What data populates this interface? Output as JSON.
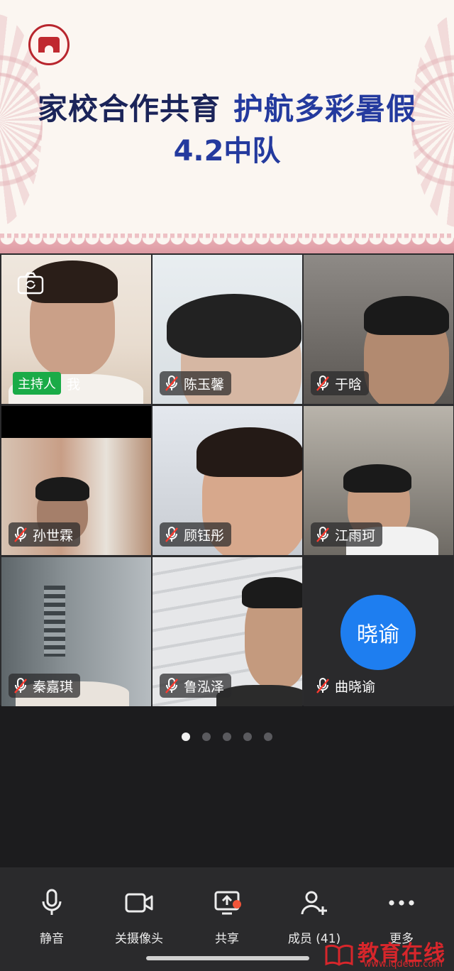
{
  "banner": {
    "title_part1": "家校合作共育",
    "title_part2": "护航多彩暑假",
    "subtitle": "4.2中队"
  },
  "participants": [
    {
      "name": "我",
      "host_label": "主持人",
      "is_host": true,
      "mic_muted": false
    },
    {
      "name": "陈玉馨",
      "mic_muted": true
    },
    {
      "name": "于晗",
      "mic_muted": true
    },
    {
      "name": "孙世霖",
      "mic_muted": true
    },
    {
      "name": "顾钰彤",
      "mic_muted": true
    },
    {
      "name": "江雨珂",
      "mic_muted": true
    },
    {
      "name": "秦嘉琪",
      "mic_muted": true
    },
    {
      "name": "鲁泓泽",
      "mic_muted": true
    },
    {
      "name": "曲晓谕",
      "mic_muted": true,
      "avatar_text": "晓谕",
      "avatar_color": "#1e7ef0"
    }
  ],
  "pager": {
    "pages": 5,
    "current": 1
  },
  "toolbar": {
    "mute": "静音",
    "camera_off": "关摄像头",
    "share": "共享",
    "members": "成员 (41)",
    "more": "更多"
  },
  "watermark": {
    "text": "教育在线",
    "url": "www.lqdedu.com",
    "color": "#d7262b"
  }
}
